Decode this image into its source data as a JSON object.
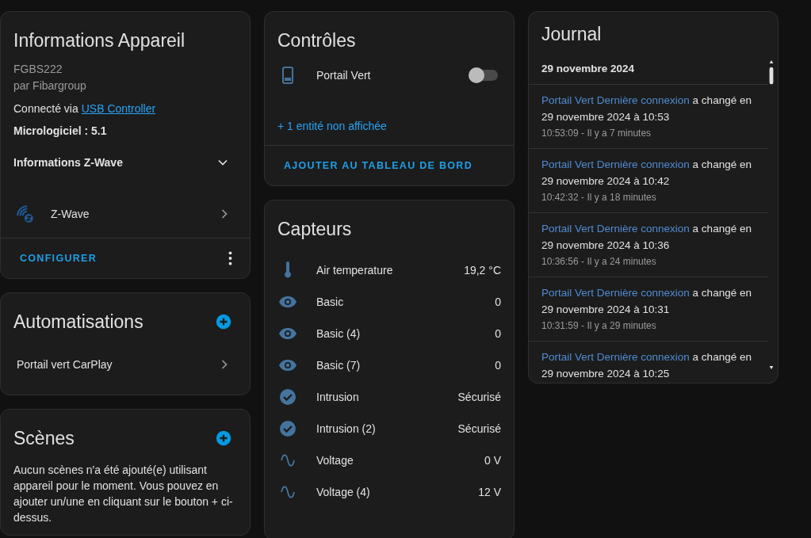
{
  "device_info": {
    "title": "Informations Appareil",
    "model": "FGBS222",
    "manufacturer": "par Fibargroup",
    "connected_label": "Connecté via",
    "connected_link": "USB Controller",
    "firmware": "Micrologiciel : 5.1",
    "expander": {
      "label": "Informations Z-Wave",
      "expanded": false
    },
    "integration": {
      "label": "Z-Wave"
    },
    "footer_button": "CONFIGURER"
  },
  "automations": {
    "title": "Automatisations",
    "items": [
      {
        "label": "Portail vert CarPlay"
      }
    ]
  },
  "scenes": {
    "title": "Scènes",
    "message": "Aucun scènes n'a été ajouté(e) utilisant appareil pour le moment. Vous pouvez en ajouter un/une en cliquant sur le bouton + ci-dessus."
  },
  "controls": {
    "title": "Contrôles",
    "items": [
      {
        "label": "Portail Vert",
        "on": false
      }
    ],
    "hidden_link": "+ 1 entité non affichée",
    "footer_button": "AJOUTER AU TABLEAU DE BORD"
  },
  "sensors": {
    "title": "Capteurs",
    "items": [
      {
        "kind": "temperature",
        "label": "Air temperature",
        "value": "19,2 °C"
      },
      {
        "kind": "eye",
        "label": "Basic",
        "value": "0"
      },
      {
        "kind": "eye",
        "label": "Basic (4)",
        "value": "0"
      },
      {
        "kind": "eye",
        "label": "Basic (7)",
        "value": "0"
      },
      {
        "kind": "check",
        "label": "Intrusion",
        "value": "Sécurisé"
      },
      {
        "kind": "check",
        "label": "Intrusion (2)",
        "value": "Sécurisé"
      },
      {
        "kind": "wave",
        "label": "Voltage",
        "value": "0 V"
      },
      {
        "kind": "wave",
        "label": "Voltage (4)",
        "value": "12 V"
      }
    ]
  },
  "journal": {
    "title": "Journal",
    "date": "29 novembre 2024",
    "entries": [
      {
        "entity": "Portail Vert Dernière connexion",
        "message": "a changé en 29 novembre 2024 à 10:53",
        "time": "10:53:09 - Il y a 7 minutes"
      },
      {
        "entity": "Portail Vert Dernière connexion",
        "message": "a changé en 29 novembre 2024 à 10:42",
        "time": "10:42:32 - Il y a 18 minutes"
      },
      {
        "entity": "Portail Vert Dernière connexion",
        "message": "a changé en 29 novembre 2024 à 10:36",
        "time": "10:36:56 - Il y a 24 minutes"
      },
      {
        "entity": "Portail Vert Dernière connexion",
        "message": "a changé en 29 novembre 2024 à 10:31",
        "time": "10:31:59 - Il y a 29 minutes"
      },
      {
        "entity": "Portail Vert Dernière connexion",
        "message": "a changé en 29 novembre 2024 à 10:25"
      }
    ]
  }
}
